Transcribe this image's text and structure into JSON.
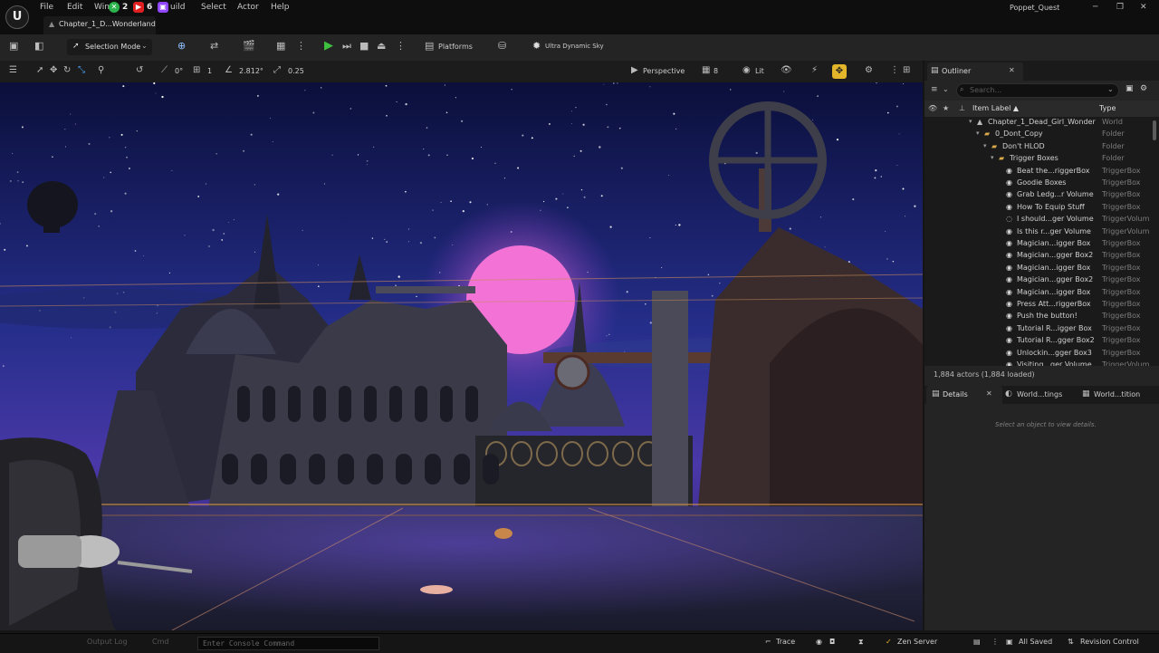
{
  "app": {
    "project_name": "Poppet_Quest",
    "document_tab": "Chapter_1_D...Wonderland",
    "menus": [
      "File",
      "Edit",
      "Win",
      "uild",
      "Select",
      "Actor",
      "Help"
    ],
    "overlay_counts": [
      "2",
      "6"
    ]
  },
  "toolbar": {
    "selection_mode": "Selection Mode",
    "platforms": "Platforms",
    "sky": "Ultra Dynamic Sky"
  },
  "viewport_toolbar": {
    "rotation_snap": "0°",
    "grid_snap": "1",
    "camera_speed_value": "2.812°",
    "scale_snap": "0.25",
    "perspective": "Perspective",
    "camera_speed": "8",
    "lit": "Lit"
  },
  "outliner": {
    "tab_label": "Outliner",
    "search_placeholder": "Search...",
    "col_label": "Item Label ▲",
    "col_type": "Type",
    "rows": [
      {
        "label": "Chapter_1_Dead_Girl_Wonder",
        "type": "World",
        "kind": "world",
        "depth": 0
      },
      {
        "label": "0_Dont_Copy",
        "type": "Folder",
        "kind": "folder",
        "depth": 1
      },
      {
        "label": "Don't HLOD",
        "type": "Folder",
        "kind": "folder",
        "depth": 2
      },
      {
        "label": "Trigger Boxes",
        "type": "Folder",
        "kind": "folder",
        "depth": 3
      },
      {
        "label": "Beat the...riggerBox",
        "type": "TriggerBox",
        "kind": "actor",
        "depth": 4
      },
      {
        "label": "Goodie Boxes",
        "type": "TriggerBox",
        "kind": "actor",
        "depth": 4
      },
      {
        "label": "Grab Ledg...r Volume",
        "type": "TriggerBox",
        "kind": "actor",
        "depth": 4
      },
      {
        "label": "How To Equip Stuff",
        "type": "TriggerBox",
        "kind": "actor",
        "depth": 4
      },
      {
        "label": "I should...ger Volume",
        "type": "TriggerVolum",
        "kind": "volume",
        "depth": 4
      },
      {
        "label": "Is this r...ger Volume",
        "type": "TriggerVolum",
        "kind": "actor",
        "depth": 4
      },
      {
        "label": "Magician...igger Box",
        "type": "TriggerBox",
        "kind": "actor",
        "depth": 4
      },
      {
        "label": "Magician...gger Box2",
        "type": "TriggerBox",
        "kind": "actor",
        "depth": 4
      },
      {
        "label": "Magician...igger Box",
        "type": "TriggerBox",
        "kind": "actor",
        "depth": 4
      },
      {
        "label": "Magician...gger Box2",
        "type": "TriggerBox",
        "kind": "actor",
        "depth": 4
      },
      {
        "label": "Magician...igger Box",
        "type": "TriggerBox",
        "kind": "actor",
        "depth": 4
      },
      {
        "label": "Press Att...riggerBox",
        "type": "TriggerBox",
        "kind": "actor",
        "depth": 4
      },
      {
        "label": "Push the button!",
        "type": "TriggerBox",
        "kind": "actor",
        "depth": 4
      },
      {
        "label": "Tutorial R...igger Box",
        "type": "TriggerBox",
        "kind": "actor",
        "depth": 4
      },
      {
        "label": "Tutorial R...gger Box2",
        "type": "TriggerBox",
        "kind": "actor",
        "depth": 4
      },
      {
        "label": "Unlockin...gger Box3",
        "type": "TriggerBox",
        "kind": "actor",
        "depth": 4
      },
      {
        "label": "Visiting...ger Volume",
        "type": "TriggerVolum",
        "kind": "actor",
        "depth": 4
      }
    ],
    "status": "1,884 actors (1,884 loaded)"
  },
  "details": {
    "tabs": [
      "Details",
      "World...tings",
      "World...tition"
    ],
    "empty_message": "Select an object to view details."
  },
  "statusbar": {
    "output_log": "Output Log",
    "cmd": "Cmd",
    "console_placeholder": "Enter Console Command",
    "trace": "Trace",
    "zen_server": "Zen Server",
    "all_saved": "All Saved",
    "revision_control": "Revision Control"
  },
  "colors": {
    "accent_green": "#3fbf3f",
    "snap_active": "#e2b52b",
    "sky_top": "#0b0f3a",
    "moon": "#f272d6"
  }
}
